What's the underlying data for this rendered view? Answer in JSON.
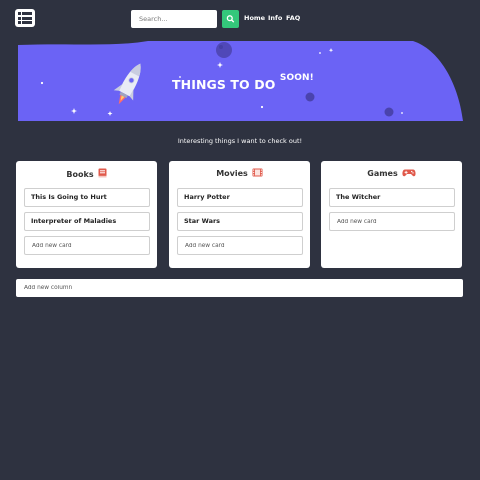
{
  "navbar": {
    "logo_icon": "list-icon",
    "search_placeholder": "Search...",
    "search_icon": "search-icon",
    "links": [
      "Home",
      "Info",
      "FAQ"
    ]
  },
  "hero": {
    "title": "THINGS TO DO",
    "title_sup": "SOON!",
    "illustration": "rocket-icon",
    "background_color": "#6b63f5"
  },
  "tagline": "Interesting things I want to check out!",
  "columns": [
    {
      "title": "Books",
      "icon": "book-icon",
      "cards": [
        "This Is Going to Hurt",
        "Interpreter of Maladies"
      ],
      "add_card_placeholder": "Add new card"
    },
    {
      "title": "Movies",
      "icon": "film-icon",
      "cards": [
        "Harry Potter",
        "Star Wars"
      ],
      "add_card_placeholder": "Add new card"
    },
    {
      "title": "Games",
      "icon": "gamepad-icon",
      "cards": [
        "The Witcher"
      ],
      "add_card_placeholder": "Add new card"
    }
  ],
  "add_column_placeholder": "Add new column",
  "colors": {
    "page_background": "#2e3240",
    "accent_green": "#34c77b",
    "hero_purple": "#6b63f5"
  }
}
